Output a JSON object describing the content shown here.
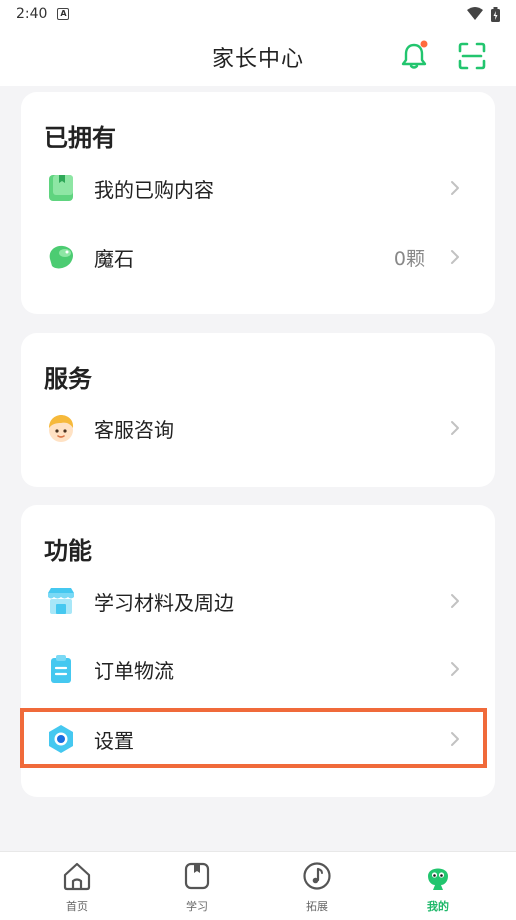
{
  "status_bar": {
    "time": "2:40",
    "notification_letter": "A"
  },
  "header": {
    "title": "家长中心"
  },
  "colors": {
    "accent": "#22c56e",
    "highlight": "#f06a3a",
    "badge": "#ff6b3d"
  },
  "sections": {
    "owned": {
      "title": "已拥有",
      "items": [
        {
          "label": "我的已购内容",
          "icon": "green-book-icon"
        },
        {
          "label": "魔石",
          "value": "0颗",
          "icon": "green-gem-icon"
        }
      ]
    },
    "service": {
      "title": "服务",
      "items": [
        {
          "label": "客服咨询",
          "icon": "support-avatar-icon"
        }
      ]
    },
    "functions": {
      "title": "功能",
      "items": [
        {
          "label": "学习材料及周边",
          "icon": "store-icon"
        },
        {
          "label": "订单物流",
          "icon": "clipboard-icon"
        },
        {
          "label": "设置",
          "icon": "settings-hex-icon"
        }
      ]
    }
  },
  "tabbar": {
    "tabs": [
      {
        "label": "首页",
        "icon": "home-icon"
      },
      {
        "label": "学习",
        "icon": "book-icon"
      },
      {
        "label": "拓展",
        "icon": "music-note-icon"
      },
      {
        "label": "我的",
        "icon": "mascot-icon",
        "active": true
      }
    ]
  }
}
